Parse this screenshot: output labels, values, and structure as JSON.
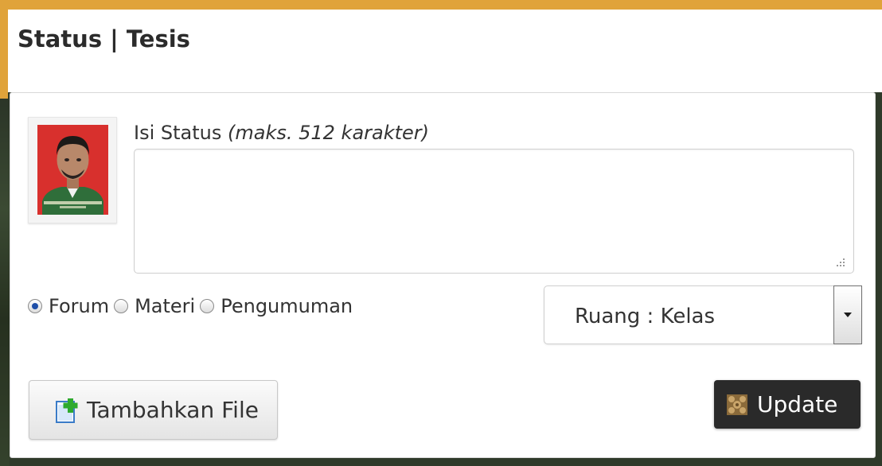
{
  "header": {
    "title": "Status | Tesis"
  },
  "status_form": {
    "label": "Isi Status",
    "hint": "(maks. 512 karakter)",
    "textarea_value": ""
  },
  "post_type": {
    "options": [
      {
        "label": "Forum",
        "checked": true
      },
      {
        "label": "Materi",
        "checked": false
      },
      {
        "label": "Pengumuman",
        "checked": false
      }
    ]
  },
  "ruang_select": {
    "selected": "Ruang : Kelas"
  },
  "buttons": {
    "add_file": "Tambahkan File",
    "update": "Update"
  },
  "colors": {
    "accent_bar": "#e0a33a",
    "update_button": "#2a2a2a",
    "radio_checked": "#1f4fa8"
  },
  "icons": {
    "add_file": "file-add-icon",
    "update": "ornament-icon",
    "select": "dropdown-arrow-icon",
    "avatar": "profile-photo"
  }
}
